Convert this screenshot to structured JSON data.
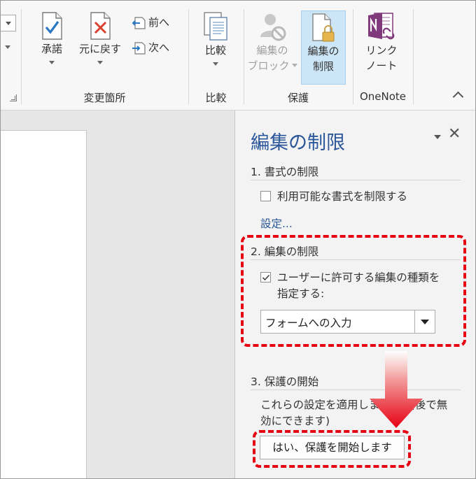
{
  "ribbon": {
    "accept": "承諾",
    "reject": "元に戻す",
    "previous": "前へ",
    "next": "次へ",
    "group_changes": "変更箇所",
    "compare": "比較",
    "group_compare": "比較",
    "block_authors_line1": "編集の",
    "block_authors_line2": "ブロック",
    "restrict_editing_line1": "編集の",
    "restrict_editing_line2": "制限",
    "group_protect": "保護",
    "linked_notes_line1": "リンク",
    "linked_notes_line2": "ノート",
    "group_onenote": "OneNote"
  },
  "pane": {
    "title": "編集の制限",
    "section1": {
      "heading": "1. 書式の制限",
      "checkbox_label": "利用可能な書式を制限する",
      "checked": false,
      "settings_link": "設定..."
    },
    "section2": {
      "heading": "2. 編集の制限",
      "checkbox_label_line1": "ユーザーに許可する編集の種類を",
      "checkbox_label_line2": "指定する:",
      "checked": true,
      "select_value": "フォームへの入力"
    },
    "section3": {
      "heading": "3. 保護の開始",
      "description_line1": "これらの設定を適用しますか? (後で無",
      "description_line2": "効にできます)",
      "start_button": "はい、保護を開始します"
    }
  },
  "colors": {
    "accent_blue": "#2b579a",
    "highlight_red": "#e60012",
    "selected_bg": "#cde6f7",
    "onenote_purple": "#80397b"
  }
}
